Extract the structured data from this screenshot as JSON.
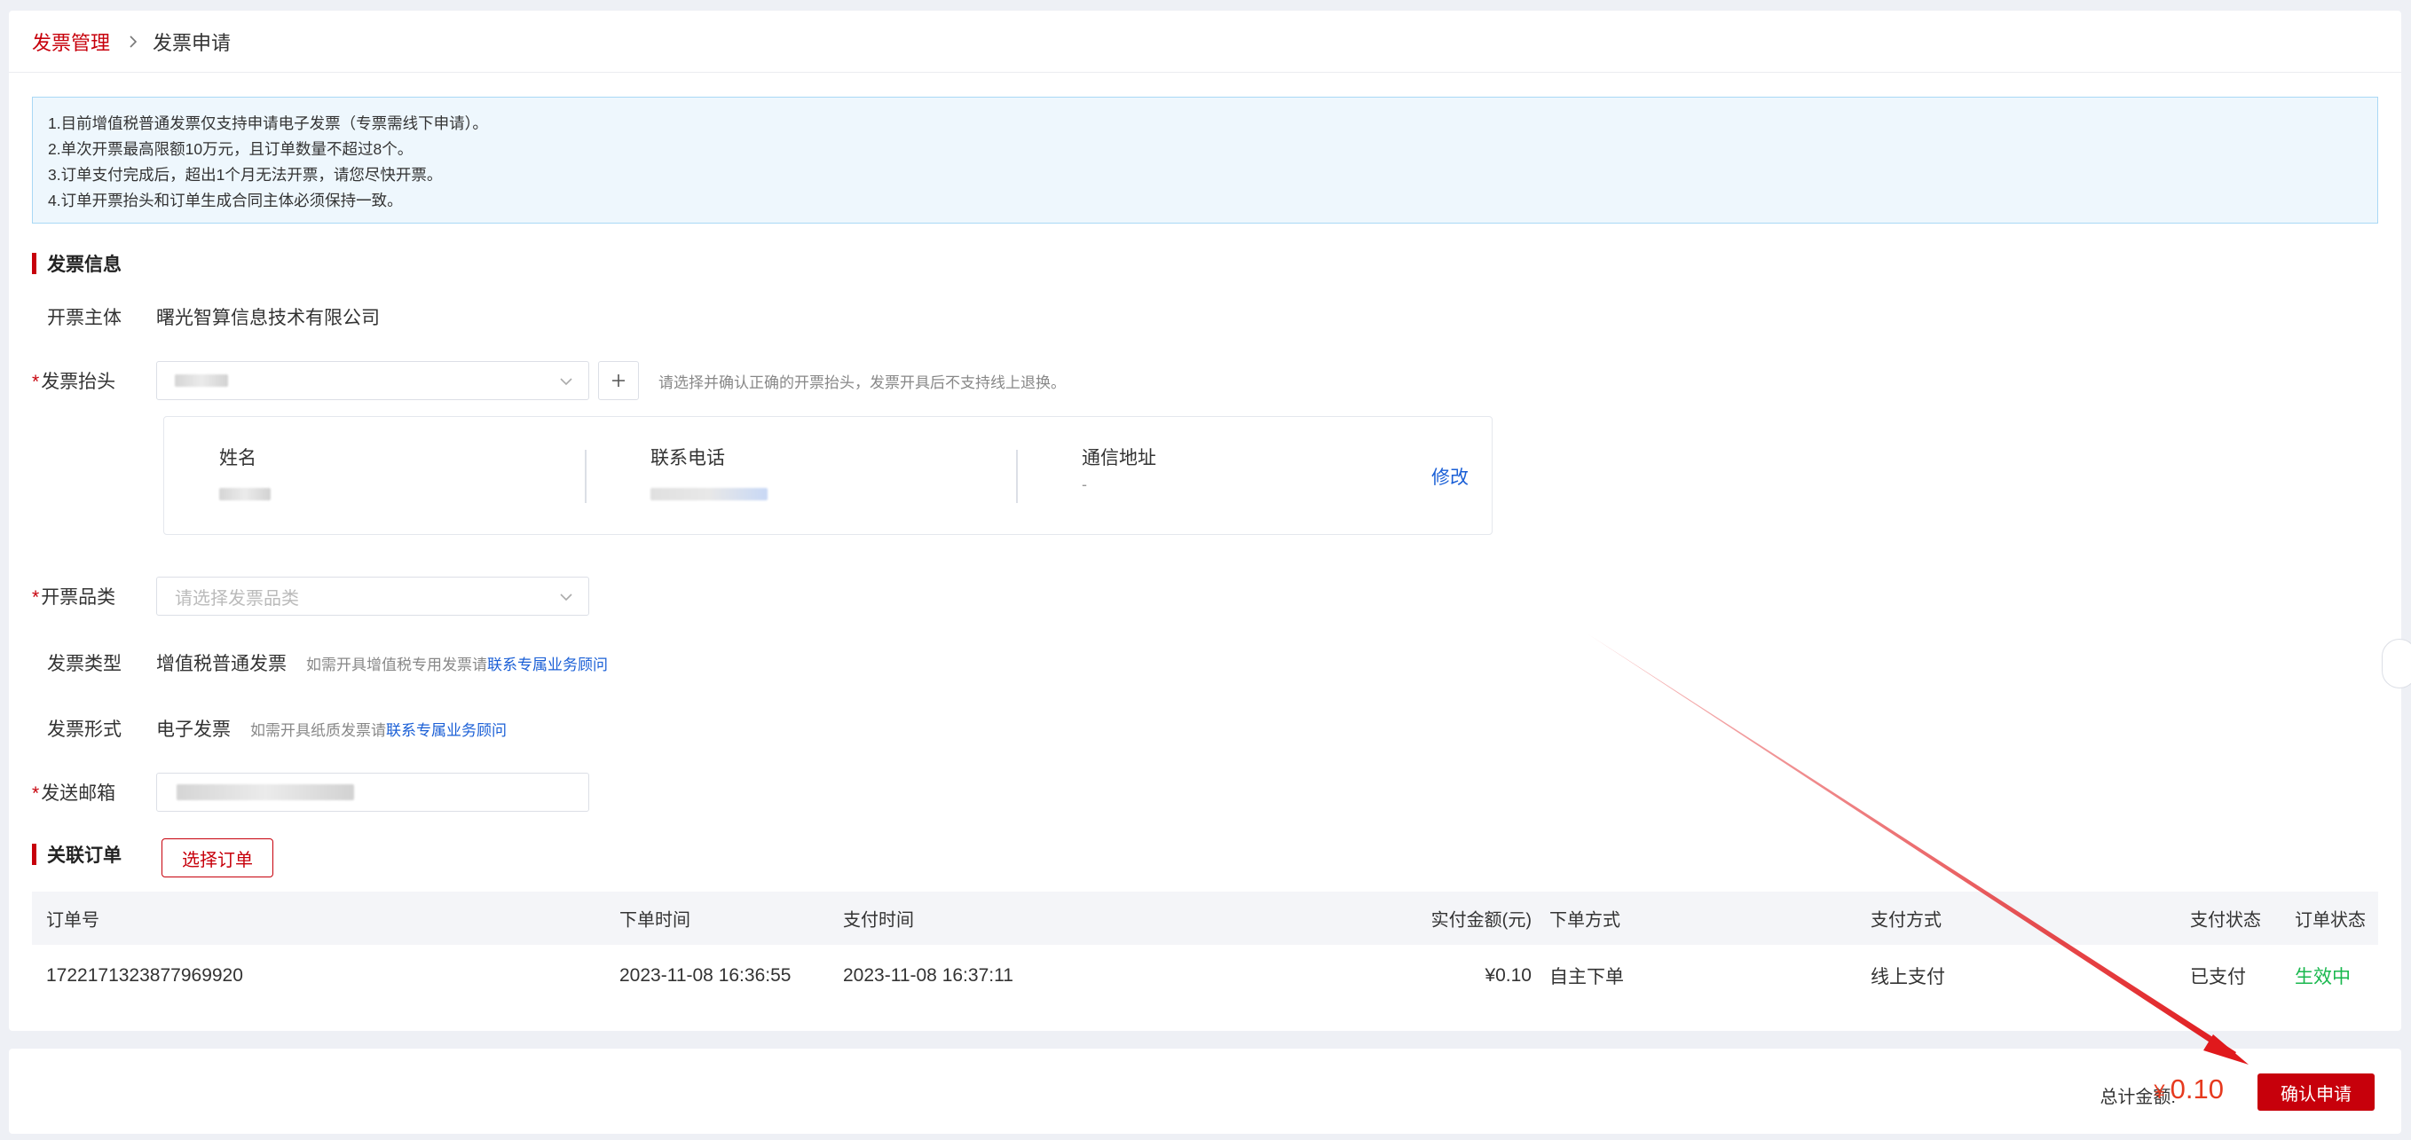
{
  "breadcrumb": {
    "parent": "发票管理",
    "current": "发票申请"
  },
  "notice": [
    "1.目前增值税普通发票仅支持申请电子发票（专票需线下申请）。",
    "2.单次开票最高限额10万元，且订单数量不超过8个。",
    "3.订单支付完成后，超出1个月无法开票，请您尽快开票。",
    "4.订单开票抬头和订单生成合同主体必须保持一致。"
  ],
  "invoice_section": {
    "title": "发票信息"
  },
  "issuer": {
    "label": "开票主体",
    "value": "曙光智算信息技术有限公司"
  },
  "title_field": {
    "required": "*",
    "label": "发票抬头",
    "hint": "请选择并确认正确的开票抬头，发票开具后不支持线上退换。"
  },
  "contact": {
    "name_label": "姓名",
    "phone_label": "联系电话",
    "address_label": "通信地址",
    "address_value": "-",
    "edit_label": "修改"
  },
  "category_field": {
    "required": "*",
    "label": "开票品类",
    "placeholder": "请选择发票品类"
  },
  "type_field": {
    "label": "发票类型",
    "value": "增值税普通发票",
    "hint": "如需开具增值税专用发票请",
    "link": "联系专属业务顾问"
  },
  "form_field": {
    "label": "发票形式",
    "value": "电子发票",
    "hint": "如需开具纸质发票请",
    "link": "联系专属业务顾问"
  },
  "email_field": {
    "required": "*",
    "label": "发送邮箱"
  },
  "orders_section": {
    "title": "关联订单",
    "select_button": "选择订单"
  },
  "table": {
    "headers": {
      "order_no": "订单号",
      "order_time": "下单时间",
      "pay_time": "支付时间",
      "amount": "实付金额(元)",
      "method": "下单方式",
      "pay_method": "支付方式",
      "pay_status": "支付状态",
      "order_status": "订单状态"
    },
    "rows": [
      {
        "order_no": "1722171323877969920",
        "order_time": "2023-11-08 16:36:55",
        "pay_time": "2023-11-08 16:37:11",
        "amount": "¥0.10",
        "method": "自主下单",
        "pay_method": "线上支付",
        "pay_status": "已支付",
        "order_status": "生效中"
      }
    ]
  },
  "footer": {
    "total_label": "总计金额:",
    "currency": "¥",
    "total_amount": "0.10",
    "confirm_button": "确认申请"
  },
  "colors": {
    "brand_red": "#c7000b",
    "link_blue": "#1a5fd6",
    "success_green": "#19b84e",
    "annotation_arrow": "#e0191c"
  }
}
